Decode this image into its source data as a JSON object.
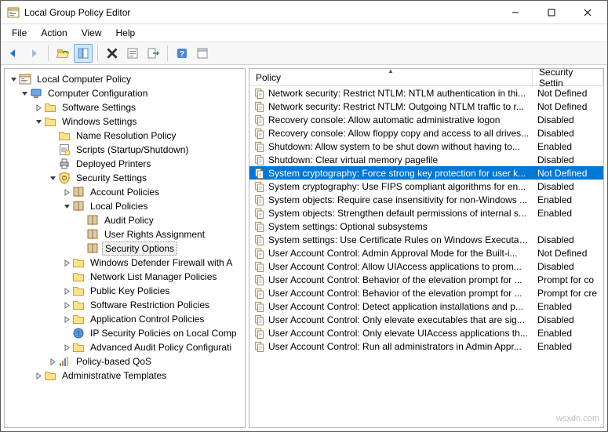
{
  "window": {
    "title": "Local Group Policy Editor"
  },
  "menubar": [
    "File",
    "Action",
    "View",
    "Help"
  ],
  "tree": {
    "root": "Local Computer Policy",
    "computer_config": "Computer Configuration",
    "software_settings": "Software Settings",
    "windows_settings": "Windows Settings",
    "name_resolution": "Name Resolution Policy",
    "scripts": "Scripts (Startup/Shutdown)",
    "deployed_printers": "Deployed Printers",
    "security_settings": "Security Settings",
    "account_policies": "Account Policies",
    "local_policies": "Local Policies",
    "audit_policy": "Audit Policy",
    "user_rights": "User Rights Assignment",
    "security_options": "Security Options",
    "windows_defender_fw": "Windows Defender Firewall with A",
    "network_list_mgr": "Network List Manager Policies",
    "public_key_policies": "Public Key Policies",
    "software_restriction": "Software Restriction Policies",
    "app_control_policies": "Application Control Policies",
    "ip_security": "IP Security Policies on Local Comp",
    "advanced_audit": "Advanced Audit Policy Configurati",
    "policy_based_qos": "Policy-based QoS",
    "admin_templates": "Administrative Templates"
  },
  "columns": {
    "policy": "Policy",
    "setting": "Security Settin"
  },
  "policies": [
    {
      "name": "Network security: Restrict NTLM: NTLM authentication in thi...",
      "setting": "Not Defined"
    },
    {
      "name": "Network security: Restrict NTLM: Outgoing NTLM traffic to r...",
      "setting": "Not Defined"
    },
    {
      "name": "Recovery console: Allow automatic administrative logon",
      "setting": "Disabled"
    },
    {
      "name": "Recovery console: Allow floppy copy and access to all drives...",
      "setting": "Disabled"
    },
    {
      "name": "Shutdown: Allow system to be shut down without having to...",
      "setting": "Enabled"
    },
    {
      "name": "Shutdown: Clear virtual memory pagefile",
      "setting": "Disabled"
    },
    {
      "name": "System cryptography: Force strong key protection for user k...",
      "setting": "Not Defined",
      "selected": true
    },
    {
      "name": "System cryptography: Use FIPS compliant algorithms for en...",
      "setting": "Disabled"
    },
    {
      "name": "System objects: Require case insensitivity for non-Windows ...",
      "setting": "Enabled"
    },
    {
      "name": "System objects: Strengthen default permissions of internal s...",
      "setting": "Enabled"
    },
    {
      "name": "System settings: Optional subsystems",
      "setting": ""
    },
    {
      "name": "System settings: Use Certificate Rules on Windows Executab...",
      "setting": "Disabled"
    },
    {
      "name": "User Account Control: Admin Approval Mode for the Built-i...",
      "setting": "Not Defined"
    },
    {
      "name": "User Account Control: Allow UIAccess applications to prom...",
      "setting": "Disabled"
    },
    {
      "name": "User Account Control: Behavior of the elevation prompt for ...",
      "setting": "Prompt for co"
    },
    {
      "name": "User Account Control: Behavior of the elevation prompt for ...",
      "setting": "Prompt for cre"
    },
    {
      "name": "User Account Control: Detect application installations and p...",
      "setting": "Enabled"
    },
    {
      "name": "User Account Control: Only elevate executables that are sig...",
      "setting": "Disabled"
    },
    {
      "name": "User Account Control: Only elevate UIAccess applications th...",
      "setting": "Enabled"
    },
    {
      "name": "User Account Control: Run all administrators in Admin Appr...",
      "setting": "Enabled"
    }
  ],
  "watermark_host": "wsxdn.com"
}
